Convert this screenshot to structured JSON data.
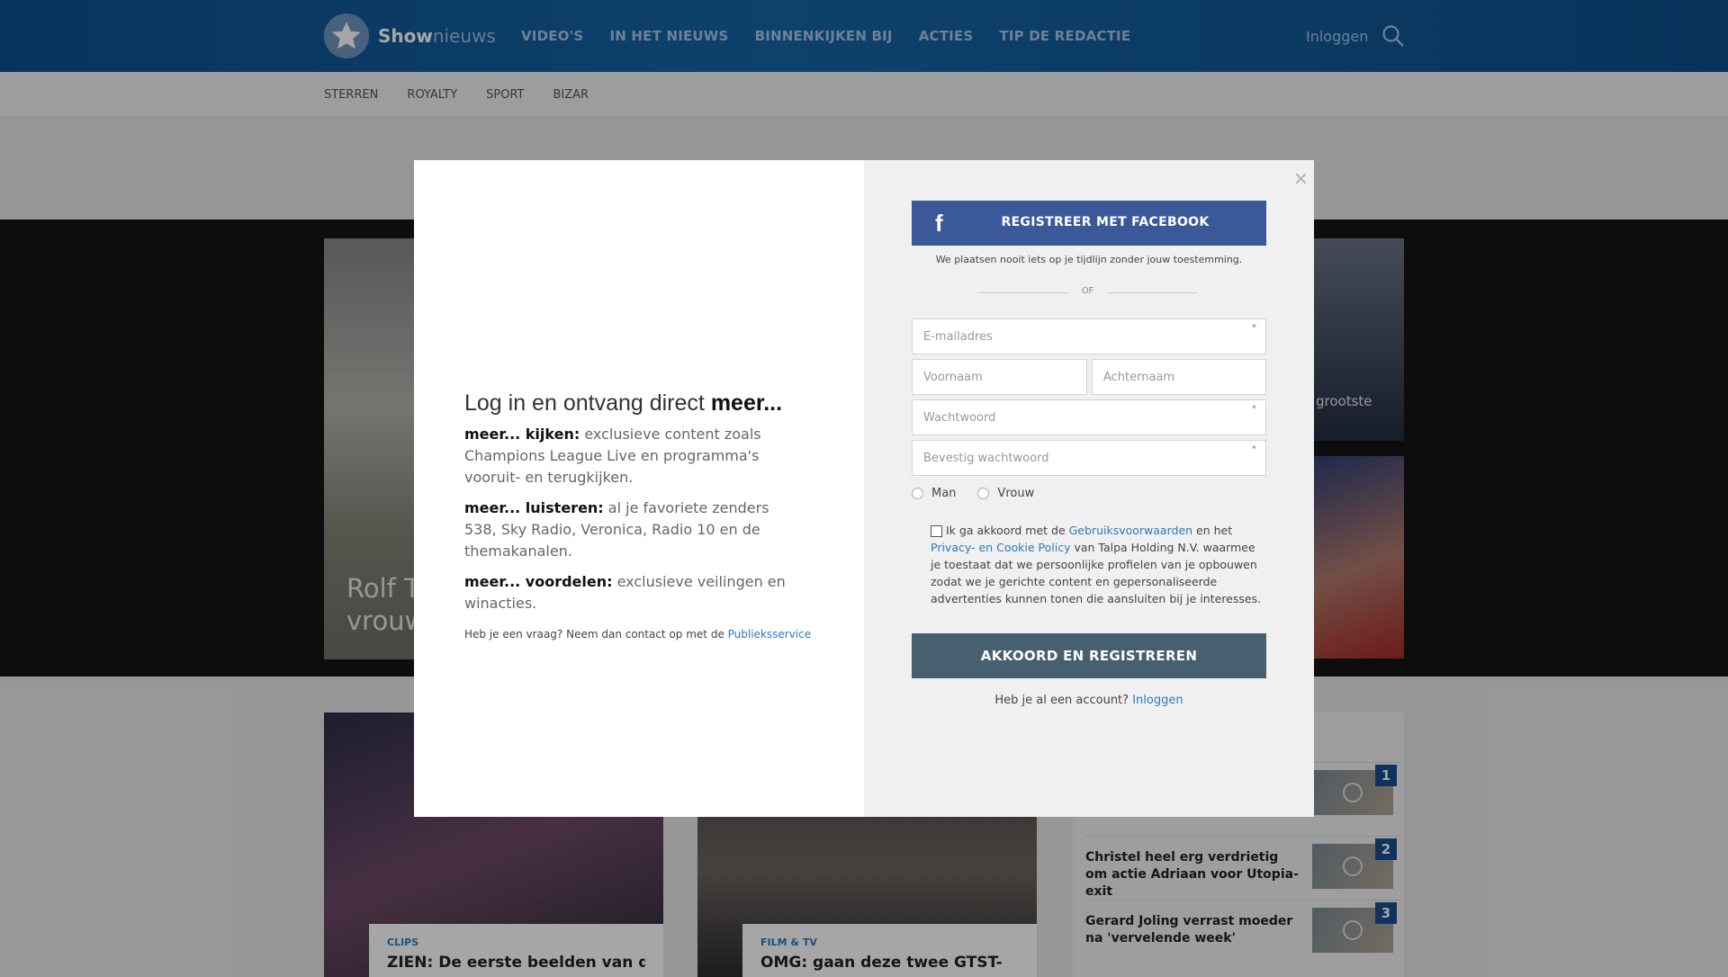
{
  "header": {
    "logo_bold": "Show",
    "logo_light": "nieuws",
    "nav": [
      "VIDEO'S",
      "IN HET NIEUWS",
      "BINNENKIJKEN BIJ",
      "ACTIES",
      "TIP DE REDACTIE"
    ],
    "login": "Inloggen"
  },
  "subnav": [
    "STERREN",
    "ROYALTY",
    "SPORT",
    "BIZAR"
  ],
  "hero": {
    "left_line1": "Rolf T",
    "left_line2": "vrouw",
    "right_top_text": "grootste"
  },
  "cards": [
    {
      "category": "CLIPS",
      "title": "ZIEN: De eerste beelden van de"
    },
    {
      "category": "FILM & TV",
      "title": "OMG: gaan deze twee GTST-"
    }
  ],
  "sidebar": {
    "items": [
      {
        "num": "1",
        "title": ""
      },
      {
        "num": "2",
        "title": "Christel heel erg verdrietig om actie Adriaan voor Utopia-exit"
      },
      {
        "num": "3",
        "title": "Gerard Joling verrast moeder na 'vervelende week'"
      }
    ]
  },
  "modal": {
    "heading_main": "Log in en ontvang direct ",
    "heading_bold": "meer...",
    "blocks": [
      {
        "lead": "meer... kijken:",
        "text": " exclusieve content zoals Champions League Live en programma's vooruit- en terugkijken."
      },
      {
        "lead": "meer... luisteren:",
        "text": " al je favoriete zenders 538, Sky Radio, Veronica, Radio 10 en de themakanalen."
      },
      {
        "lead": "meer... voordelen:",
        "text": " exclusieve veilingen en winacties."
      }
    ],
    "contact_text": "Heb je een vraag? Neem dan contact op met de ",
    "contact_link": "Publieksservice",
    "facebook_button": "REGISTREER MET FACEBOOK",
    "facebook_note": "We plaatsen nooit iets op je tijdlijn zonder jouw toestemming.",
    "or": "OF",
    "fields": {
      "email": "E-mailadres",
      "firstname": "Voornaam",
      "lastname": "Achternaam",
      "password": "Wachtwoord",
      "confirm": "Bevestig wachtwoord"
    },
    "gender_male": "Man",
    "gender_female": "Vrouw",
    "terms_1": "Ik ga akkoord met de ",
    "terms_link1": "Gebruiksvoorwaarden",
    "terms_2": " en het ",
    "terms_link2": "Privacy- en Cookie Policy",
    "terms_3": " van Talpa Holding N.V. waarmee je toestaat dat we persoonlijke profielen van je opbouwen zodat we je gerichte content en gepersonaliseerde advertenties kunnen tonen die aansluiten bij je interesses.",
    "submit": "AKKOORD EN REGISTREREN",
    "has_account": "Heb je al een account? ",
    "has_account_link": "Inloggen",
    "close": "×"
  }
}
